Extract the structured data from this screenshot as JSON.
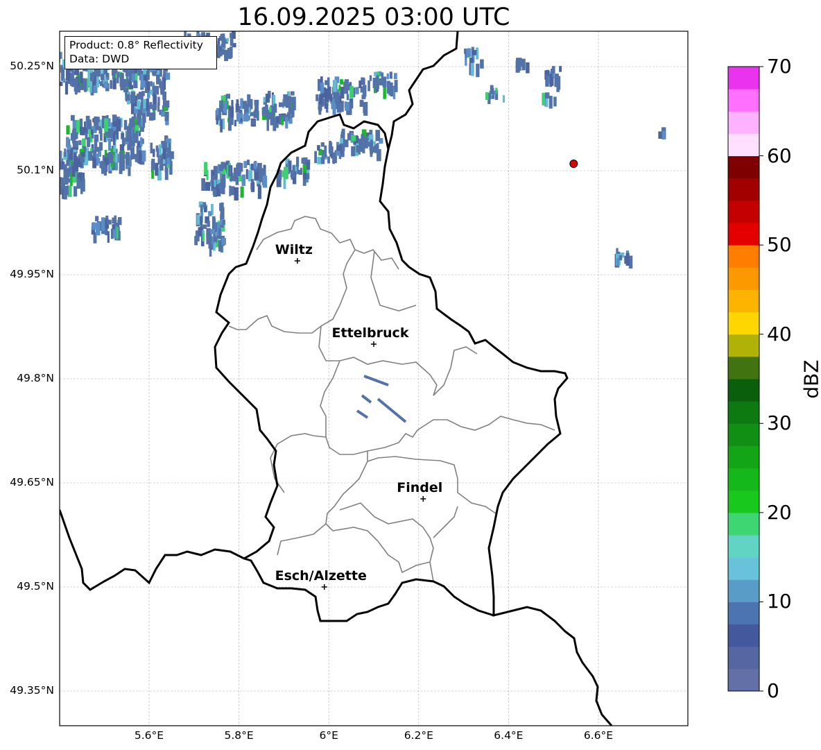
{
  "title": "16.09.2025 03:00 UTC",
  "info": {
    "product": "Product: 0.8° Reflectivity",
    "data": "Data: DWD"
  },
  "axes": {
    "lat_ticks": [
      "50.25°N",
      "50.1°N",
      "49.95°N",
      "49.8°N",
      "49.65°N",
      "49.5°N",
      "49.35°N"
    ],
    "lon_ticks": [
      "5.6°E",
      "5.8°E",
      "6°E",
      "6.2°E",
      "6.4°E",
      "6.6°E"
    ],
    "grid": true
  },
  "cities": [
    {
      "name": "Wiltz",
      "lon": 5.93,
      "lat": 49.97
    },
    {
      "name": "Ettelbruck",
      "lon": 6.1,
      "lat": 49.85
    },
    {
      "name": "Findel",
      "lon": 6.21,
      "lat": 49.627
    },
    {
      "name": "Esch/Alzette",
      "lon": 5.99,
      "lat": 49.5
    }
  ],
  "marker": {
    "lon": 6.545,
    "lat": 50.11,
    "color": "#e00000"
  },
  "colorbar": {
    "label": "dBZ",
    "ticks": [
      "0",
      "10",
      "20",
      "30",
      "40",
      "50",
      "60",
      "70"
    ],
    "min": 0,
    "max": 70,
    "step": 2.5,
    "colors": [
      "#6370a8",
      "#5566a3",
      "#44589e",
      "#4b74b0",
      "#5a9cc8",
      "#68c2dc",
      "#62d4c4",
      "#3ed672",
      "#18c81c",
      "#14b81a",
      "#12a616",
      "#108f14",
      "#0c7a10",
      "#0a5f0c",
      "#417410",
      "#b0b208",
      "#ffd700",
      "#fcb400",
      "#fd9900",
      "#ff7d00",
      "#e50000",
      "#c40000",
      "#a20000",
      "#7e0000",
      "#ffe0ff",
      "#ffb2ff",
      "#ff70ff",
      "#ea33ee"
    ]
  },
  "echo_colors": [
    "#5372a8",
    "#4b64a0",
    "#5a8ec6",
    "#64bcd4",
    "#60d0c0",
    "#3cd070",
    "#1ab82a"
  ]
}
